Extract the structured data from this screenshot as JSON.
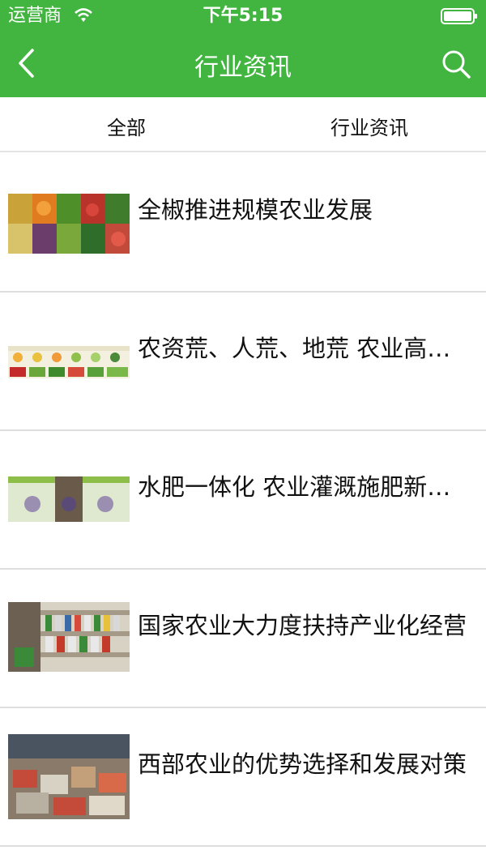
{
  "status": {
    "carrier": "运营商",
    "time": "下午5:15"
  },
  "nav": {
    "title": "行业资讯",
    "back_icon": "chevron-left-icon",
    "search_icon": "search-icon"
  },
  "tabs": [
    {
      "label": "全部"
    },
    {
      "label": "行业资讯"
    }
  ],
  "articles": [
    {
      "title": "全椒推进规模农业发展"
    },
    {
      "title": "农资荒、人荒、地荒 农业高…"
    },
    {
      "title": "水肥一体化 农业灌溉施肥新…"
    },
    {
      "title": "国家农业大力度扶持产业化经营"
    },
    {
      "title": "西部农业的优势选择和发展对策"
    }
  ],
  "colors": {
    "header": "#41b53f",
    "divider": "#dedede"
  }
}
